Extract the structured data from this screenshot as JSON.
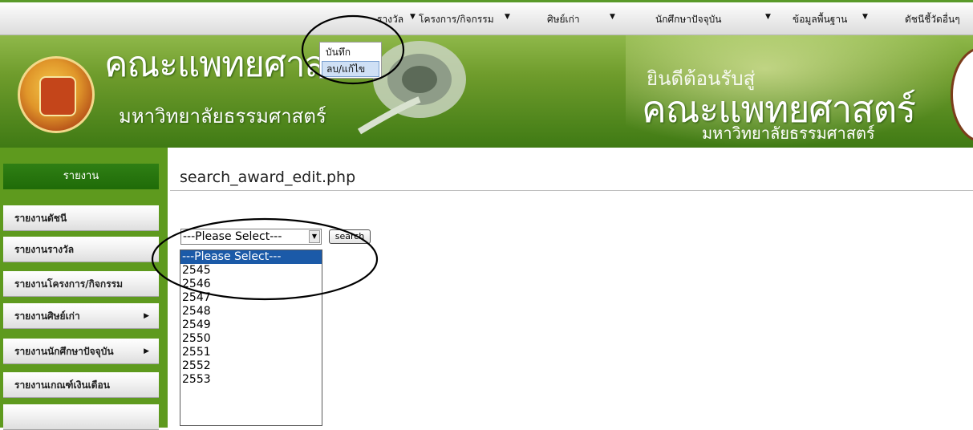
{
  "top_menu": [
    {
      "label": "รางวัล",
      "arrow": "▼"
    },
    {
      "label": "โครงการ/กิจกรรม",
      "arrow": "▼"
    },
    {
      "label": "ศิษย์เก่า",
      "arrow": "▼"
    },
    {
      "label": "นักศึกษาปัจจุบัน",
      "arrow": "▼"
    },
    {
      "label": "ข้อมูลพื้นฐาน",
      "arrow": "▼"
    },
    {
      "label": "ดัชนีชี้วัดอื่นๆ",
      "arrow": ""
    }
  ],
  "award_submenu": [
    "บันทึก",
    "ลบ/แก้ไข"
  ],
  "banner": {
    "title": "คณะแพทยศาสตร์",
    "subtitle": "มหาวิทยาลัยธรรมศาสตร์",
    "welcome": "ยินดีต้อนรับสู่",
    "right_title": "คณะแพทยศาสตร์",
    "right_subtitle": "มหาวิทยาลัยธรรมศาสตร์"
  },
  "sidebar": {
    "header": "รายงาน",
    "items": [
      {
        "label": "รายงานดัชนี",
        "arrow": ""
      },
      {
        "label": "รายงานรางวัล",
        "arrow": ""
      },
      {
        "label": "รายงานโครงการ/กิจกรรม",
        "arrow": ""
      },
      {
        "label": "รายงานศิษย์เก่า",
        "arrow": "▶"
      },
      {
        "label": "รายงานนักศึกษาปัจจุบัน",
        "arrow": "▶"
      },
      {
        "label": "รายงานเกณฑ์เงินเดือน",
        "arrow": ""
      }
    ]
  },
  "main": {
    "page_title": "search_award_edit.php",
    "select_value": "---Please Select---",
    "search_label": "search",
    "options": [
      "---Please Select---",
      "2545",
      "2546",
      "2547",
      "2548",
      "2549",
      "2550",
      "2551",
      "2552",
      "2553"
    ]
  },
  "colors": {
    "accent": "#1b5aa8",
    "brand_green": "#5e9a1e"
  }
}
